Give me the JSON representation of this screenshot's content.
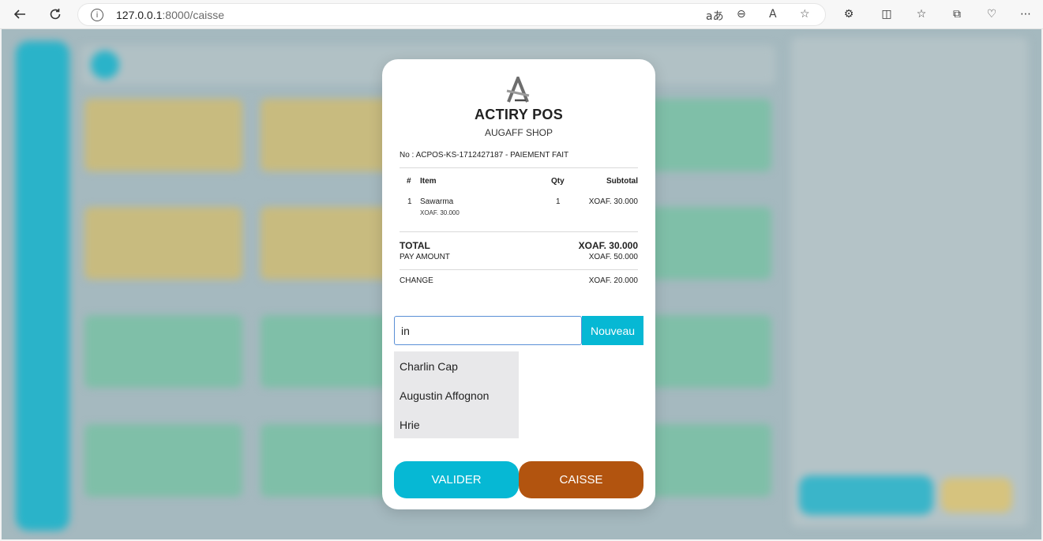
{
  "browser": {
    "url_host": "127.0.0.1",
    "url_rest": ":8000/caisse"
  },
  "modal": {
    "brand": "ACTIRY POS",
    "shop": "AUGAFF SHOP",
    "receipt_no": "No : ACPOS-KS-1712427187 - PAIEMENT FAIT",
    "headers": {
      "num": "#",
      "item": "Item",
      "qty": "Qty",
      "subtotal": "Subtotal"
    },
    "rows": [
      {
        "num": "1",
        "item": "Sawarma",
        "unit_price": "XOAF. 30.000",
        "qty": "1",
        "subtotal": "XOAF. 30.000"
      }
    ],
    "total_label": "TOTAL",
    "total_value": "XOAF. 30.000",
    "pay_label": "PAY AMOUNT",
    "pay_value": "XOAF. 50.000",
    "change_label": "CHANGE",
    "change_value": "XOAF. 20.000",
    "search_value": "in",
    "new_button": "Nouveau",
    "suggestions": [
      "Charlin Cap",
      "Augustin Affognon",
      "Hrie"
    ],
    "valider_button": "VALIDER",
    "caisse_button": "CAISSE"
  },
  "colors": {
    "accent": "#06b8d4",
    "caisse": "#b2540f",
    "overlay": "#a5b9bf"
  }
}
